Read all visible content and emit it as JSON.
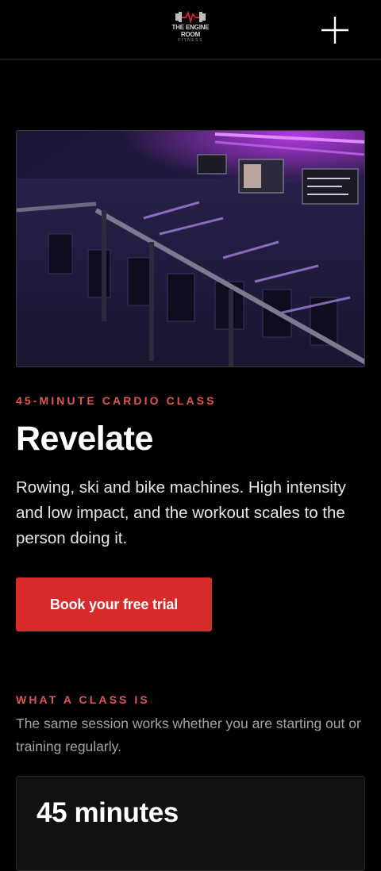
{
  "header": {
    "logo_line1": "THE ENGINE",
    "logo_line2": "ROOM",
    "logo_line3": "FITNESS",
    "menu_icon": "plus-icon"
  },
  "hero": {
    "image_alt": "",
    "image_icon": "gym-room-photo"
  },
  "intro": {
    "eyebrow": "45-MINUTE CARDIO CLASS",
    "title": "Revelate",
    "description": "Rowing, ski and bike machines. High intensity and low impact, and the workout scales to the person doing it.",
    "cta_label": "Book your free trial"
  },
  "about": {
    "eyebrow": "WHAT A CLASS IS",
    "text": "The same session works whether you are starting out or training regularly."
  },
  "card": {
    "title": "45 minutes"
  },
  "colors": {
    "accent": "#d72b2b",
    "eyebrow": "#e0564f",
    "background": "#000000"
  }
}
